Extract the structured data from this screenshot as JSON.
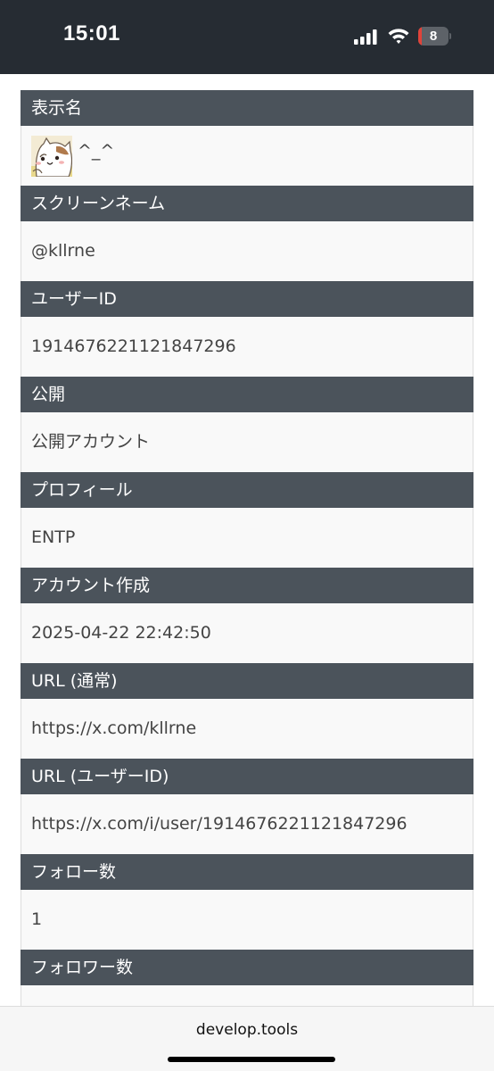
{
  "status_bar": {
    "time": "15:01",
    "battery_level": "8",
    "icons": [
      "cellular-signal-icon",
      "wifi-icon",
      "battery-icon"
    ]
  },
  "colors": {
    "status_bar_bg": "#262c33",
    "header_bg": "#4b535b",
    "row_bg": "#f9f9f9",
    "battery_low": "#e0433a"
  },
  "profile": {
    "display_name": {
      "label": "表示名",
      "value": "^_^",
      "avatar_icon": "cat-avatar-icon"
    },
    "screen_name": {
      "label": "スクリーンネーム",
      "value": "@kllrne"
    },
    "user_id": {
      "label": "ユーザーID",
      "value": "1914676221121847296"
    },
    "visibility": {
      "label": "公開",
      "value": "公開アカウント"
    },
    "bio": {
      "label": "プロフィール",
      "value": "ENTP"
    },
    "created_at": {
      "label": "アカウント作成",
      "value": "2025-04-22 22:42:50"
    },
    "url_normal": {
      "label": "URL (通常)",
      "value": "https://x.com/kllrne"
    },
    "url_user_id": {
      "label": "URL (ユーザーID)",
      "value": "https://x.com/i/user/1914676221121847296"
    },
    "following": {
      "label": "フォロー数",
      "value": "1"
    },
    "followers": {
      "label": "フォロワー数"
    }
  },
  "browser": {
    "url": "develop.tools"
  }
}
